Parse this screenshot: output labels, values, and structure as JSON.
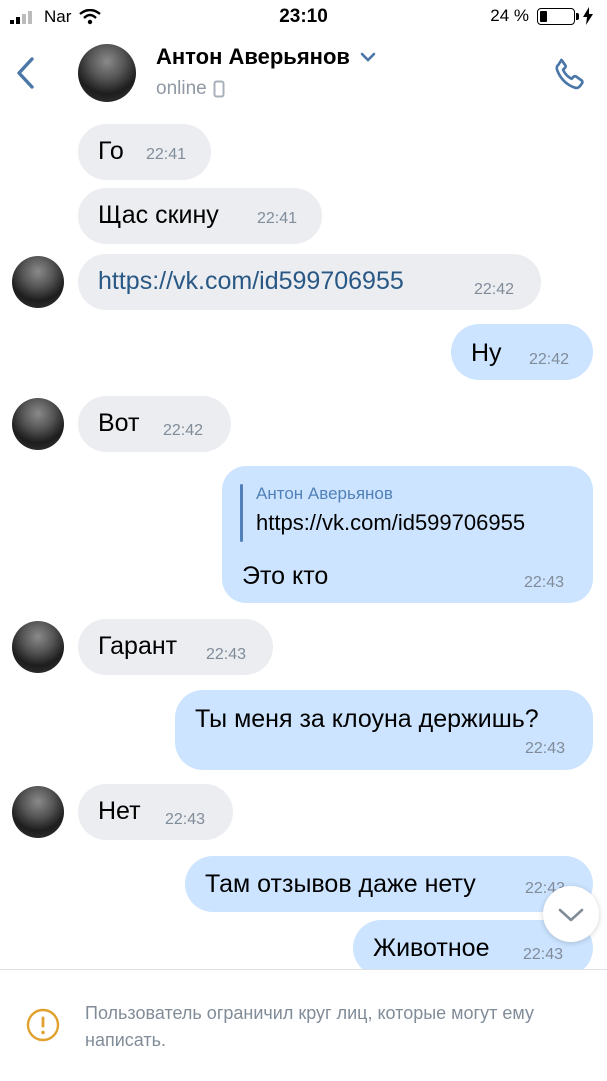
{
  "status_bar": {
    "carrier": "Nar",
    "time": "23:10",
    "battery_percent": "24 %",
    "battery_level": 0.24
  },
  "header": {
    "contact_name": "Антон Аверьянов",
    "status": "online"
  },
  "messages": [
    {
      "dir": "in",
      "text": "Го",
      "time": "22:41"
    },
    {
      "dir": "in",
      "text": "Щас скину",
      "time": "22:41"
    },
    {
      "dir": "in",
      "text": "https://vk.com/id599706955",
      "time": "22:42",
      "is_link": true
    },
    {
      "dir": "out",
      "text": "Ну",
      "time": "22:42"
    },
    {
      "dir": "in",
      "text": "Вот",
      "time": "22:42"
    },
    {
      "dir": "out",
      "reply_author": "Антон Аверьянов",
      "reply_text": "https://vk.com/id599706955",
      "text": "Это кто",
      "time": "22:43"
    },
    {
      "dir": "in",
      "text": "Гарант",
      "time": "22:43"
    },
    {
      "dir": "out",
      "text": "Ты меня за клоуна держишь?",
      "time": "22:43"
    },
    {
      "dir": "in",
      "text": "Нет",
      "time": "22:43"
    },
    {
      "dir": "out",
      "text": "Там отзывов даже нету",
      "time": "22:43"
    },
    {
      "dir": "out",
      "text": "Животное",
      "time": "22:43"
    }
  ],
  "footer": {
    "notice": "Пользователь ограничил круг лиц, которые могут ему написать."
  },
  "colors": {
    "accent": "#2a5885",
    "incoming": "#ebedf0",
    "outgoing": "#cce4ff",
    "secondary": "#818c99"
  }
}
